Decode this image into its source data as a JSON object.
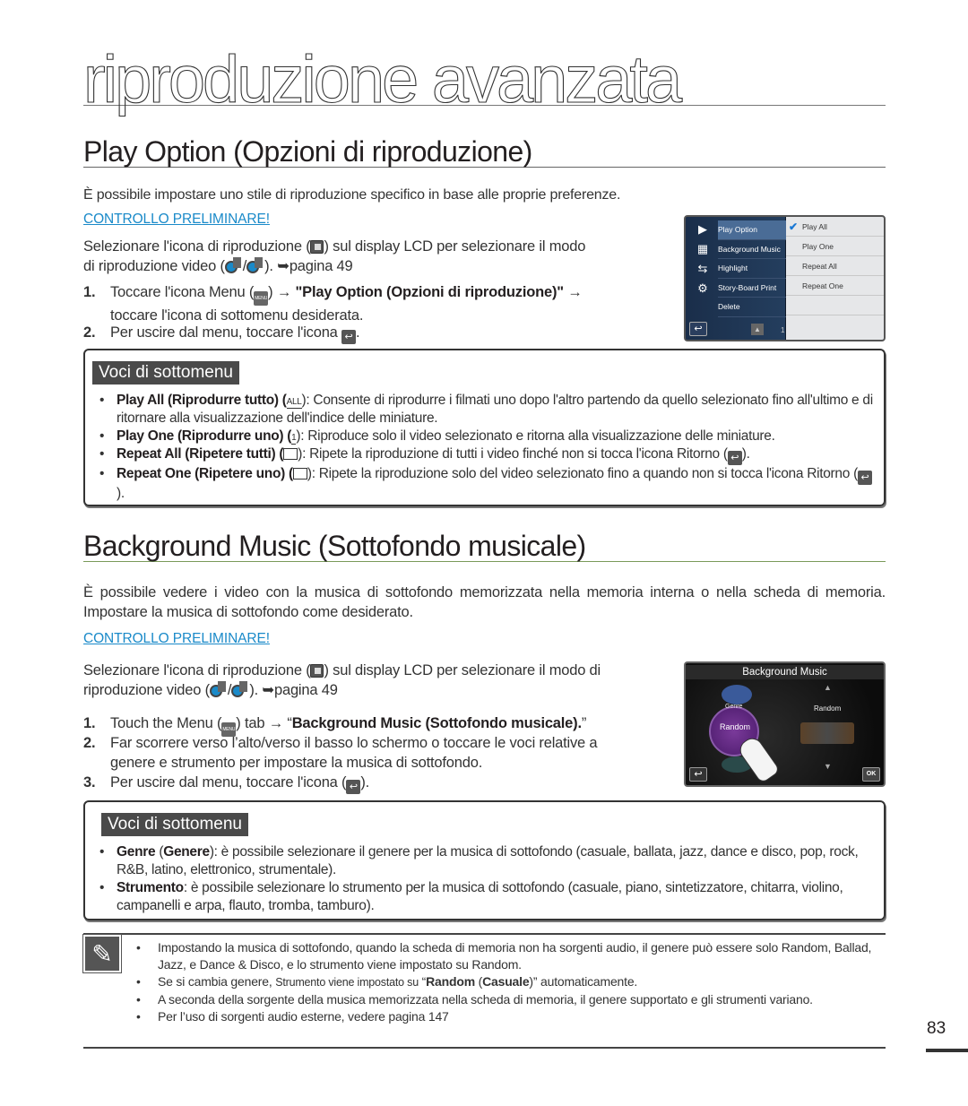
{
  "chapter_title": "riproduzione avanzata",
  "section1": {
    "title": "Play Option (Opzioni di riproduzione)",
    "intro": "È possibile impostare uno stile di riproduzione specifico in base alle proprie preferenze.",
    "precheck_label": "CONTROLLO PRELIMINARE!",
    "precheck_line1_a": "Selezionare l'icona di riproduzione (",
    "precheck_line1_b": ") sul display LCD per selezionare il modo",
    "precheck_line2_a": "di riproduzione video (",
    "precheck_line2_b": "). ➥pagina 49",
    "steps": [
      {
        "num": "1.",
        "text_a": "Toccare l'icona Menu (",
        "text_b": ") → ",
        "bold": "\"Play Option (Opzioni di riproduzione)\"",
        "text_c": " →",
        "cont": "toccare l'icona di sottomenu desiderata."
      },
      {
        "num": "2.",
        "text_a": "Per uscire dal menu, toccare l'icona ",
        "text_b": "."
      }
    ],
    "lcd": {
      "menu_items": [
        "Play Option",
        "Background Music",
        "Highlight",
        "Story-Board Print",
        "Delete"
      ],
      "options": [
        "Play All",
        "Play One",
        "Repeat All",
        "Repeat One"
      ],
      "selected_option": "Play All",
      "page": "1"
    },
    "submenu": {
      "title": "Voci di sottomenu",
      "items": [
        {
          "label": "Play All (Riprodurre tutto) (",
          "icon": "ALL",
          "text": "): Consente di riprodurre i filmati uno dopo l'altro partendo da quello selezionato fino all'ultimo e di ritornare alla visualizzazione dell'indice delle miniature."
        },
        {
          "label": "Play One (Riprodurre uno) (",
          "icon": "1",
          "text": "): Riproduce solo il video selezionato e ritorna alla visualizzazione delle miniature."
        },
        {
          "label": "Repeat All (Ripetere tutti) (",
          "icon": "",
          "text": "): Ripete la riproduzione di tutti i video finché non si tocca l'icona Ritorno (",
          "text_end": ")."
        },
        {
          "label": "Repeat One (Ripetere uno) (",
          "icon": "",
          "text": "): Ripete la riproduzione solo del video selezionato fino a quando non si tocca l'icona Ritorno (",
          "text_end": ")."
        }
      ]
    }
  },
  "section2": {
    "title": "Background Music (Sottofondo musicale)",
    "intro": "È possibile vedere i video con la musica di sottofondo memorizzata nella memoria interna o nella scheda di memoria. Impostare la musica di sottofondo come desiderato.",
    "precheck_label": "CONTROLLO PRELIMINARE!",
    "precheck_line1_a": "Selezionare l'icona di riproduzione (",
    "precheck_line1_b": ") sul display LCD per selezionare il modo di",
    "precheck_line2_a": "riproduzione video (",
    "precheck_line2_b": "). ➥pagina 49",
    "steps": [
      {
        "num": "1.",
        "text_a": "Touch the Menu (",
        "text_b": ") tab → “",
        "bold": "Background Music (Sottofondo musicale).",
        "text_c": "”"
      },
      {
        "num": "2.",
        "text_a": "Far scorrere verso l’alto/verso il basso lo schermo o toccare le voci relative a",
        "cont": "genere e strumento per impostare la musica di sottofondo."
      },
      {
        "num": "3.",
        "text_a": "Per uscire dal menu, toccare l'icona (",
        "text_b": ")."
      }
    ],
    "lcd": {
      "title": "Background Music",
      "genre_label": "Genre",
      "genre_value": "Random",
      "instrument_value": "Random",
      "ok_label": "OK"
    },
    "submenu": {
      "title": "Voci di sottomenu",
      "items": [
        {
          "bold1": "Genre",
          "mid": " (",
          "bold2": "Genere",
          "text": "): è possibile selezionare il genere per la musica di sottofondo (casuale, ballata, jazz, dance e disco, pop, rock, R&B, latino, elettronico, strumentale)."
        },
        {
          "bold1": "Strumento",
          "text": ": è possibile selezionare lo strumento per la musica di sottofondo (casuale, piano, sintetizzatore, chitarra, violino, campanelli e arpa, flauto, tromba, tamburo)."
        }
      ]
    }
  },
  "notes": {
    "items": [
      "Impostando la musica di sottofondo, quando la scheda di memoria non ha sorgenti audio, il genere può essere solo Random, Ballad, Jazz, e Dance & Disco, e lo strumento viene impostato su Random.",
      {
        "a": "Se si cambia genere, ",
        "small": "Strumento viene impostato su",
        "b": " “",
        "bold1": "Random",
        "c": " (",
        "bold2": "Casuale",
        "d": ")” automaticamente."
      },
      "A seconda della sorgente della musica memorizzata nella scheda di memoria, il genere supportato e gli strumenti variano.",
      "Per l’uso di sorgenti audio esterne, vedere pagina 147"
    ]
  },
  "page_number": "83"
}
